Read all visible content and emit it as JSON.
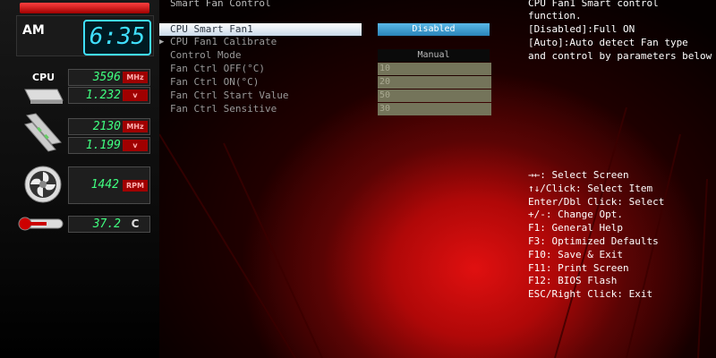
{
  "monitor": {
    "ampm": "AM",
    "time": "6:35",
    "cpu_label": "CPU",
    "cpu_freq": "3596",
    "cpu_freq_unit": "MHz",
    "cpu_volt": "1.232",
    "cpu_volt_unit": "v",
    "mem_freq": "2130",
    "mem_freq_unit": "MHz",
    "mem_volt": "1.199",
    "mem_volt_unit": "v",
    "fan_rpm": "1442",
    "fan_unit": "RPM",
    "temp": "37.2",
    "temp_unit": "C"
  },
  "section_title": "Smart Fan Control",
  "settings": [
    {
      "label": "CPU Smart Fan1"
    },
    {
      "label": "CPU Fan1 Calibrate"
    },
    {
      "label": "Control Mode"
    },
    {
      "label": "Fan Ctrl OFF(°C)"
    },
    {
      "label": "Fan Ctrl ON(°C)"
    },
    {
      "label": "Fan Ctrl Start Value"
    },
    {
      "label": "Fan Ctrl Sensitive"
    }
  ],
  "values": {
    "smart_fan": "Disabled",
    "control_mode": "Manual",
    "fan_off": "10",
    "fan_on": "20",
    "start_value": "50",
    "sensitive": "30"
  },
  "help": {
    "line1": "CPU Fan1 Smart control",
    "line2": "function.",
    "line3": "[Disabled]:Full ON",
    "line4": "[Auto]:Auto detect Fan type",
    "line5": "and control by parameters below"
  },
  "keys": [
    "→←: Select Screen",
    "↑↓/Click: Select Item",
    "Enter/Dbl Click: Select",
    "+/-: Change Opt.",
    "F1: General Help",
    "F3: Optimized Defaults",
    "F10: Save & Exit",
    "F11: Print Screen",
    "F12: BIOS Flash",
    "ESC/Right Click: Exit"
  ]
}
